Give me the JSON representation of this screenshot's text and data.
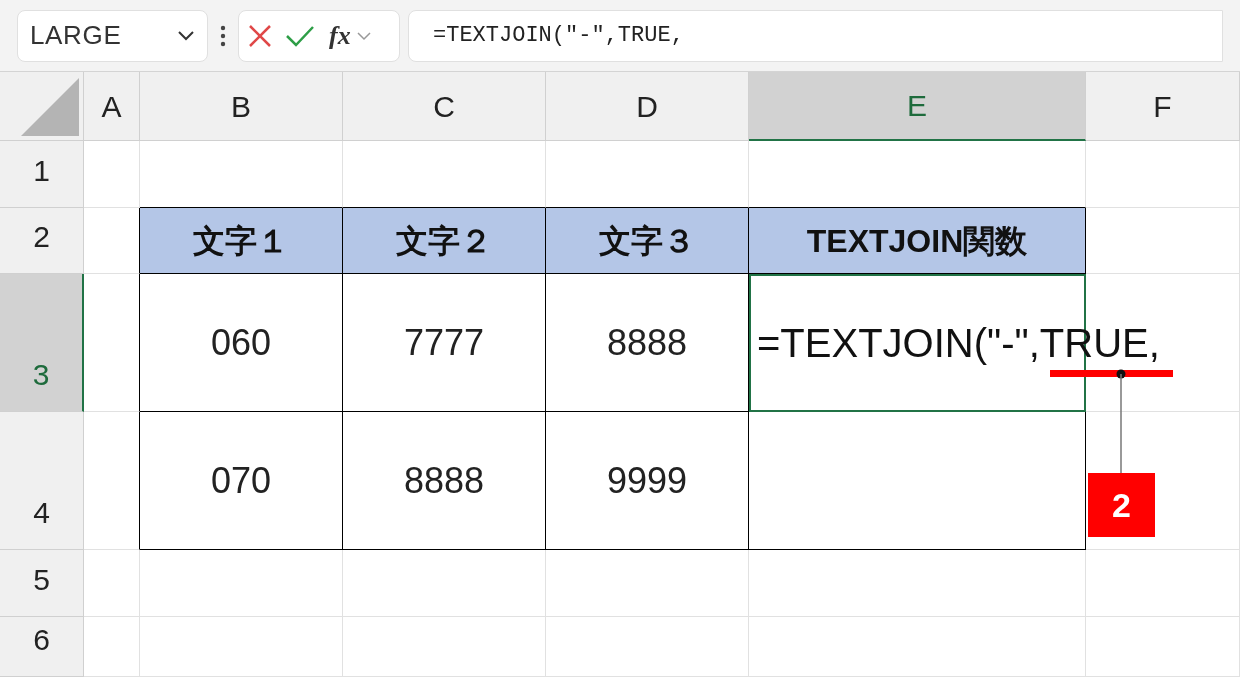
{
  "name_box": {
    "value": "LARGE"
  },
  "function_button": {
    "label": "fx"
  },
  "formula_bar": {
    "value": "=TEXTJOIN(\"-\",TRUE,"
  },
  "columns": [
    {
      "label": "A",
      "selected": false
    },
    {
      "label": "B",
      "selected": false
    },
    {
      "label": "C",
      "selected": false
    },
    {
      "label": "D",
      "selected": false
    },
    {
      "label": "E",
      "selected": true
    },
    {
      "label": "F",
      "selected": false
    }
  ],
  "rows": [
    {
      "label": "1",
      "selected": false
    },
    {
      "label": "2",
      "selected": false,
      "cells": [
        {
          "kind": "header",
          "text": "文字１"
        },
        {
          "kind": "header",
          "text": "文字２"
        },
        {
          "kind": "header",
          "text": "文字３"
        },
        {
          "kind": "header",
          "text": "TEXTJOIN関数"
        }
      ]
    },
    {
      "label": "3",
      "selected": true,
      "cells": [
        {
          "kind": "value",
          "text": "060"
        },
        {
          "kind": "value",
          "text": "7777"
        },
        {
          "kind": "value",
          "text": "8888"
        },
        {
          "kind": "editing",
          "text": "=TEXTJOIN(\"-\",TRUE,"
        }
      ]
    },
    {
      "label": "4",
      "selected": false,
      "cells": [
        {
          "kind": "value",
          "text": "070"
        },
        {
          "kind": "value",
          "text": "8888"
        },
        {
          "kind": "value",
          "text": "9999"
        },
        {
          "kind": "value"
        }
      ]
    },
    {
      "label": "5",
      "selected": false
    },
    {
      "label": "6",
      "selected": false
    }
  ],
  "callout": {
    "label": "2"
  }
}
